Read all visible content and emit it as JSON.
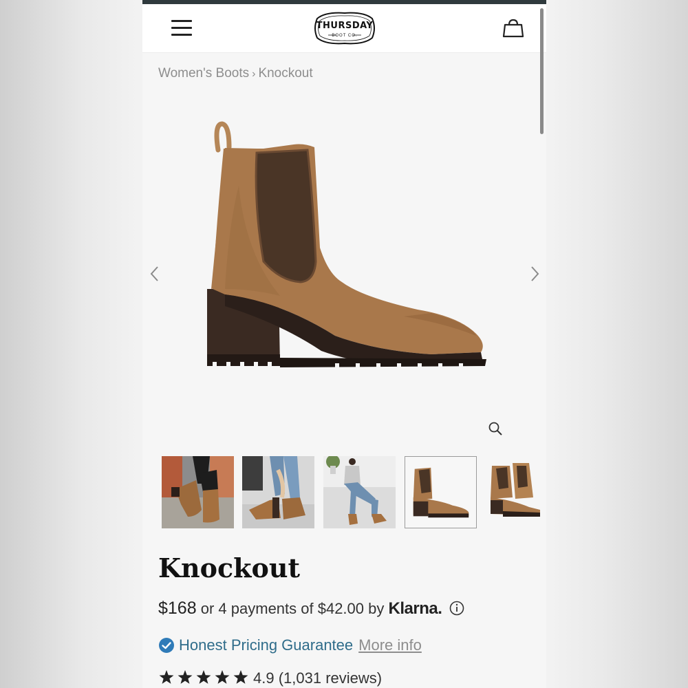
{
  "header": {
    "brand": "THURSDAY",
    "brand_sub": "BOOT CO."
  },
  "breadcrumb": {
    "items": [
      "Women's Boots",
      "Knockout"
    ],
    "separator": "›"
  },
  "product": {
    "title": "Knockout",
    "price": "$168",
    "installments_text": "or 4 payments of $42.00 by",
    "payment_provider": "Klarna.",
    "guarantee": "Honest Pricing Guarantee",
    "more_info": "More info",
    "rating_value": "4.9",
    "review_count": "(1,031 reviews)",
    "stars": 5
  },
  "gallery": {
    "thumbnail_count": 5,
    "selected_index": 3,
    "thumbnails": [
      "lifestyle-feet-street",
      "lifestyle-seated-jeans",
      "lifestyle-sitting-wall",
      "product-side",
      "product-pair"
    ]
  },
  "colors": {
    "accent": "#2f6c8a",
    "check": "#2f7bb8",
    "boot_suede": "#a9784b",
    "boot_elastic": "#4a3526",
    "sole": "#2b1f1a"
  }
}
